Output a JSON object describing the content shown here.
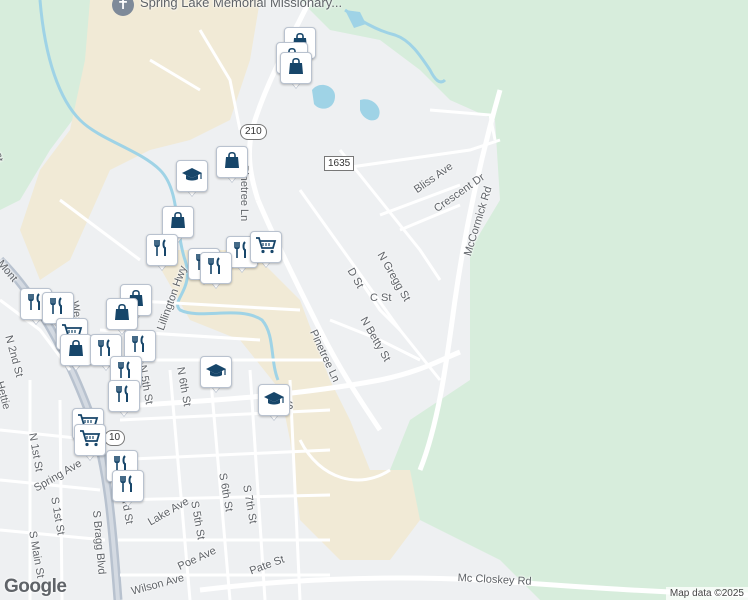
{
  "map": {
    "colors": {
      "land": "#eef0f2",
      "forest": "#d7eddc",
      "sand": "#f1ead6",
      "water": "#9fd3e6",
      "road": "#ffffff",
      "highway": "#b8c2cf",
      "marker_icon": "#17466a"
    },
    "place": {
      "name": "Spring Lake Memorial Missionary...",
      "icon": "cross-icon"
    },
    "streets": [
      "Pinetree Ln",
      "Pinetree Ln",
      "Bliss Ave",
      "Crescent Dr",
      "McCormick Rd",
      "N Gregg St",
      "D St",
      "C St",
      "N Betty St",
      "Lillington Hwy",
      "Mont",
      "N 2nd St",
      "Hettie",
      "N 1st St",
      "S 1st St",
      "S Main St",
      "Spring Ave",
      "Lake Ave",
      "S 5th St",
      "S 6th St",
      "S 7th St",
      "Poe Ave",
      "Pate St",
      "Wilson Ave",
      "S Bragg Blvd",
      "Mc Closkey Rd",
      "N 6th St",
      "N 5th St",
      "Wea",
      "S",
      "ard St",
      "St"
    ],
    "route_shields": [
      "210",
      "1635",
      "10"
    ],
    "markers": [
      {
        "icon": "shopping-bag-icon"
      },
      {
        "icon": "shopping-bag-icon"
      },
      {
        "icon": "shopping-bag-icon"
      },
      {
        "icon": "school-icon"
      },
      {
        "icon": "shopping-bag-icon"
      },
      {
        "icon": "shopping-bag-icon"
      },
      {
        "icon": "restaurant-icon"
      },
      {
        "icon": "restaurant-icon"
      },
      {
        "icon": "restaurant-icon"
      },
      {
        "icon": "shopping-cart-icon"
      },
      {
        "icon": "restaurant-icon"
      },
      {
        "icon": "restaurant-icon"
      },
      {
        "icon": "restaurant-icon"
      },
      {
        "icon": "shopping-bag-icon"
      },
      {
        "icon": "shopping-bag-icon"
      },
      {
        "icon": "shopping-cart-icon"
      },
      {
        "icon": "shopping-bag-icon"
      },
      {
        "icon": "restaurant-icon"
      },
      {
        "icon": "restaurant-icon"
      },
      {
        "icon": "school-icon"
      },
      {
        "icon": "school-icon"
      },
      {
        "icon": "restaurant-icon"
      },
      {
        "icon": "shopping-cart-icon"
      },
      {
        "icon": "restaurant-icon"
      },
      {
        "icon": "shopping-cart-icon"
      },
      {
        "icon": "restaurant-icon"
      },
      {
        "icon": "restaurant-icon"
      }
    ],
    "logo": "Google",
    "attribution": "Map data ©2025"
  }
}
